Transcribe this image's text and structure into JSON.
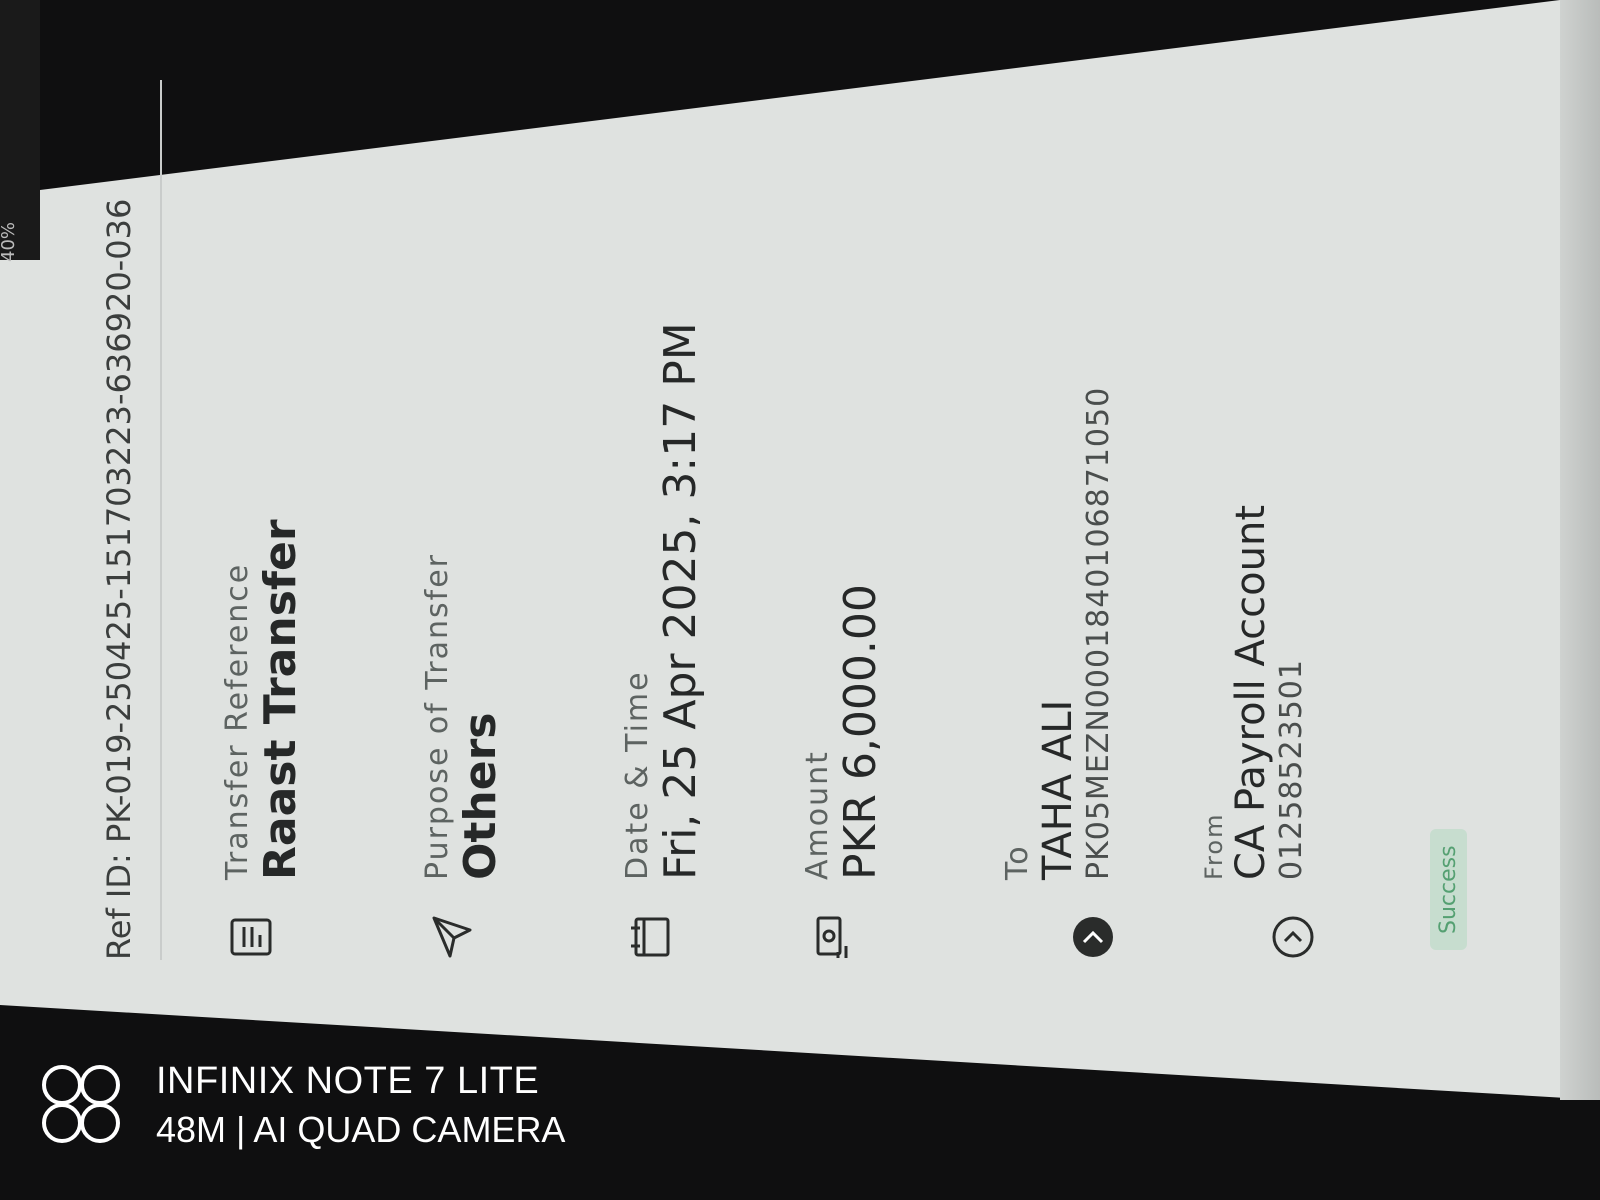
{
  "status": {
    "badge": "Success"
  },
  "statusbar": {
    "text": "40%"
  },
  "from": {
    "label": "From",
    "name": "CA Payroll Account",
    "account": "01258523501"
  },
  "to": {
    "label": "To",
    "name": "TAHA ALI",
    "account": "PK05MEZN0001840106871050"
  },
  "amount": {
    "label": "Amount",
    "value": "PKR 6,000.00"
  },
  "datetime": {
    "label": "Date & Time",
    "value": "Fri, 25 Apr 2025, 3:17 PM"
  },
  "purpose": {
    "label": "Purpose of Transfer",
    "value": "Others"
  },
  "reference": {
    "label": "Transfer Reference",
    "value": "Raast Transfer"
  },
  "ref_id": "Ref ID: PK-019-250425-151703223-636920-036",
  "watermark": {
    "line1": "INFINIX NOTE 7 LITE",
    "line2": "48M | AI QUAD CAMERA"
  },
  "icons": {
    "from": "chevron-right-circle-icon",
    "to": "chevron-right-filled-circle-icon",
    "amount": "cash-icon",
    "datetime": "calendar-icon",
    "purpose": "send-plane-icon",
    "reference": "document-icon"
  }
}
